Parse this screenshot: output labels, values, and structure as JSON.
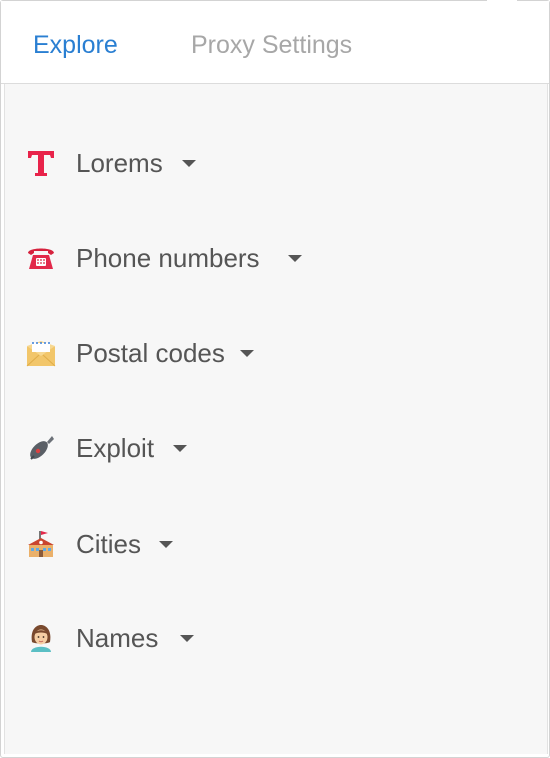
{
  "tabs": {
    "explore": "Explore",
    "proxy_settings": "Proxy Settings"
  },
  "colors": {
    "active_tab": "#2a7fd2",
    "inactive_tab": "#a7a7a7",
    "label": "#555555",
    "panel_bg": "#f7f7f7"
  },
  "menu": {
    "items": [
      {
        "label": "Lorems",
        "icon": "letter-t-icon"
      },
      {
        "label": "Phone numbers",
        "icon": "telephone-icon"
      },
      {
        "label": "Postal codes",
        "icon": "envelope-icon"
      },
      {
        "label": "Exploit",
        "icon": "bomb-icon"
      },
      {
        "label": "Cities",
        "icon": "school-building-icon"
      },
      {
        "label": "Names",
        "icon": "woman-icon"
      }
    ]
  }
}
